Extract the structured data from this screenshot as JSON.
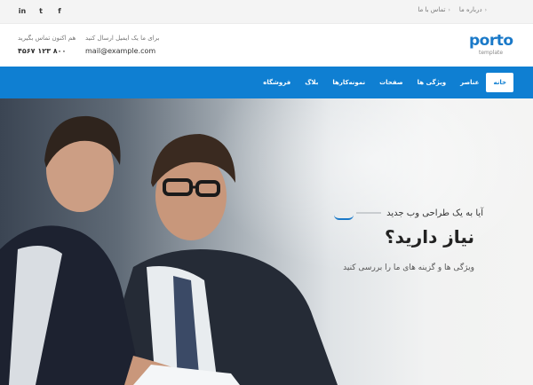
{
  "topbar": {
    "social": [
      {
        "icon": "facebook-icon",
        "glyph": "f"
      },
      {
        "icon": "twitter-icon",
        "glyph": "t"
      },
      {
        "icon": "linkedin-icon",
        "glyph": "in"
      }
    ],
    "links": [
      {
        "label": "درباره ما"
      },
      {
        "label": "تماس با ما"
      }
    ]
  },
  "header": {
    "phone_label": "هم اکنون تماس بگیرید",
    "phone_value": "۸۰۰ ۱۲۳ ۴۵۶۷",
    "email_label": "برای ما یک ایمیل ارسال کنید",
    "email_value": "mail@example.com",
    "logo_word": "porto",
    "logo_sub": "template",
    "brand_color": "#1a79c8"
  },
  "nav": {
    "color": "#0f7fd2",
    "items": [
      {
        "label": "خانه",
        "active": true
      },
      {
        "label": "عناصر"
      },
      {
        "label": "ویژگی ها"
      },
      {
        "label": "صفحات"
      },
      {
        "label": "نمونه‌کارها"
      },
      {
        "label": "بلاگ"
      },
      {
        "label": "فروشگاه"
      }
    ]
  },
  "hero": {
    "line1": "آیا به یک طراحی وب جدید",
    "headline": "نیاز دارید؟",
    "sub": "ویژگی ها و گزینه های ما را بررسی کنید"
  }
}
